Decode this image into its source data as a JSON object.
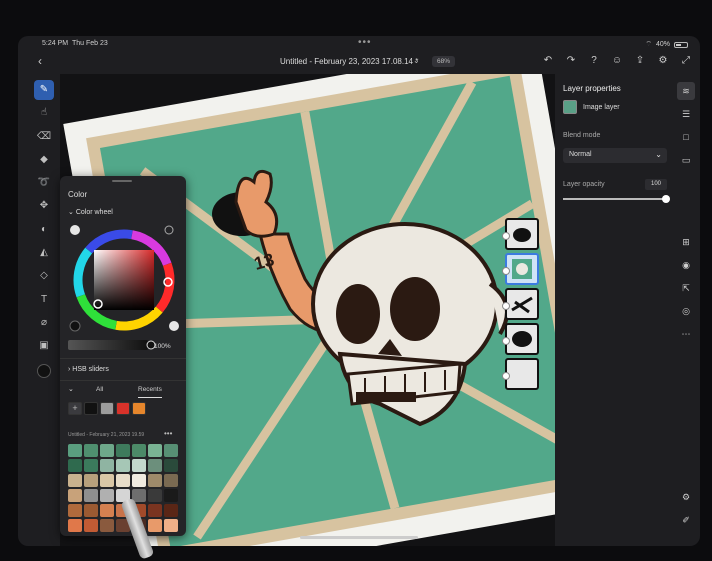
{
  "status": {
    "time": "5:24 PM",
    "date": "Thu Feb 23",
    "battery": "40%"
  },
  "topbar": {
    "title": "Untitled - February 23, 2023 17.08.14 *",
    "zoom": "68%"
  },
  "left_tools": [
    "brush-icon",
    "smudge-icon",
    "eraser-icon",
    "pencil-eraser-icon",
    "lasso-icon",
    "move-icon",
    "adjust-icon",
    "paint-bucket-icon",
    "shape-icon",
    "text-icon",
    "eyedropper-icon",
    "image-icon"
  ],
  "color_panel": {
    "title": "Color",
    "wheel_label": "Color wheel",
    "opacity": "100%",
    "hsb_label": "HSB sliders",
    "tabs": [
      "All",
      "Recents"
    ],
    "recent_colors": [
      "#111111",
      "#9c9c9c",
      "#d8322a",
      "#e6862c"
    ],
    "library_title": "Untitled - February 21, 2023 19.59",
    "library_colors": [
      "#5a9e7f",
      "#4f8f6f",
      "#6ea88a",
      "#3e7a5c",
      "#4c8a68",
      "#7ab494",
      "#578f74",
      "#2f6a4e",
      "#3b7a5c",
      "#8fb4a2",
      "#a6c7b6",
      "#c4d8cd",
      "#6c8f7c",
      "#2a4a3b",
      "#c9b28e",
      "#b7a07c",
      "#d9c7a6",
      "#e7ddc9",
      "#f0ebe0",
      "#9e8a6a",
      "#7a6a52",
      "#c8a27a",
      "#8f8f8f",
      "#b0b0b0",
      "#d5d5d5",
      "#6e6e6e",
      "#3a3a3a",
      "#1a1a1a",
      "#b06a3c",
      "#9b5a32",
      "#d48050",
      "#c8734a",
      "#a14a2a",
      "#7a3420",
      "#5a2616",
      "#e0784a",
      "#c25b34",
      "#8a5a3e",
      "#6a4030",
      "#4a2a20",
      "#e89a6a",
      "#f0b088"
    ]
  },
  "layer_properties": {
    "title": "Layer properties",
    "layer_name": "Image layer",
    "blend_label": "Blend mode",
    "blend_value": "Normal",
    "opacity_label": "Layer opacity",
    "opacity_value": "100"
  },
  "right_tools": [
    "layers-icon",
    "adjustments-icon",
    "square-icon",
    "comment-icon",
    "add-layer-icon",
    "visibility-icon",
    "layer-export-icon",
    "mask-icon",
    "more-icon"
  ],
  "bottom_tools": [
    "settings-icon",
    "pen-icon"
  ],
  "colors": {
    "canvas_teal": "#52a88a",
    "paper_tan": "#d7c3a0",
    "skull": "#ece8e0",
    "hand": "#e89a6a",
    "ink": "#2b1a12",
    "accent": "#2f5fb0"
  }
}
